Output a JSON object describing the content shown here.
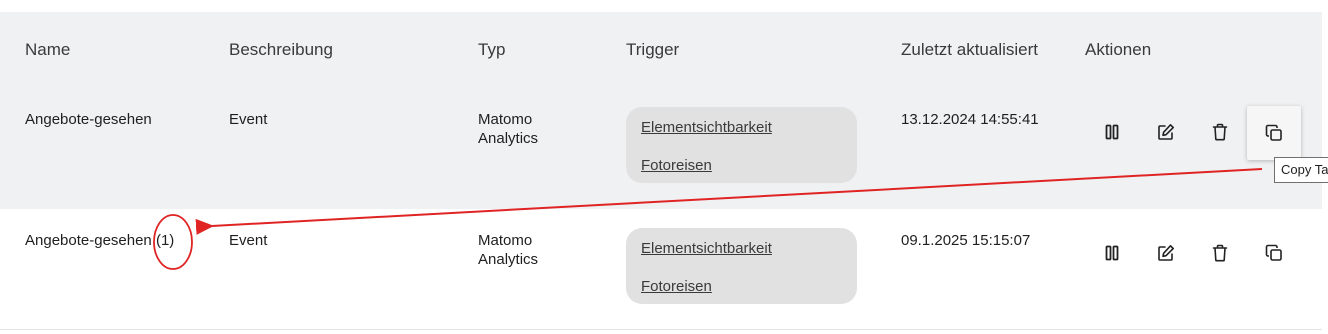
{
  "table": {
    "headers": {
      "name": "Name",
      "description": "Beschreibung",
      "type": "Typ",
      "trigger": "Trigger",
      "updated": "Zuletzt aktualisiert",
      "actions": "Aktionen"
    },
    "rows": [
      {
        "name": "Angebote-gesehen",
        "description": "Event",
        "type": "Matomo Analytics",
        "triggers": [
          "Elementsichtbarkeit",
          "Fotoreisen"
        ],
        "updated": "13.12.2024 14:55:41"
      },
      {
        "name": "Angebote-gesehen (1)",
        "description": "Event",
        "type": "Matomo Analytics",
        "triggers": [
          "Elementsichtbarkeit",
          "Fotoreisen"
        ],
        "updated": "09.1.2025 15:15:07"
      }
    ]
  },
  "tooltip": {
    "text": "Copy Ta"
  },
  "icons": {
    "pause": "pause-icon",
    "edit": "edit-icon",
    "delete": "trash-icon",
    "copy": "copy-icon"
  },
  "colors": {
    "header_bg": "#f0f1f3",
    "pill_bg": "#e1e1e1",
    "annotation": "#e02424"
  }
}
